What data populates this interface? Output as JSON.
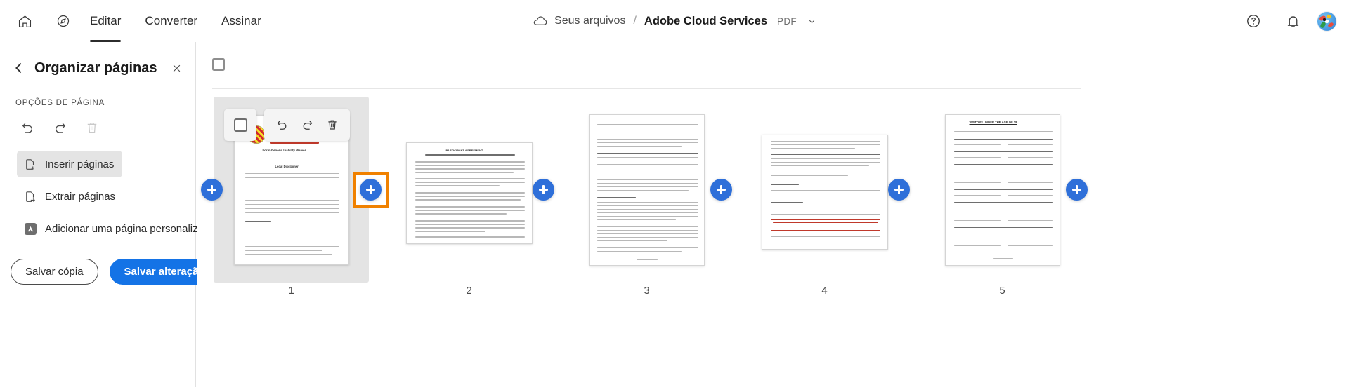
{
  "topbar": {
    "home_icon": "home-icon",
    "compass_icon": "compass-icon",
    "menu": [
      {
        "label": "Editar",
        "active": true
      },
      {
        "label": "Converter",
        "active": false
      },
      {
        "label": "Assinar",
        "active": false
      }
    ],
    "breadcrumb": {
      "cloud_icon": "cloud-icon",
      "root": "Seus arquivos",
      "separator": "/",
      "title": "Adobe Cloud Services",
      "extension": "PDF",
      "caret_icon": "chevron-down-icon"
    },
    "right": {
      "help_icon": "help-circle-icon",
      "bell_icon": "bell-icon",
      "avatar": "user-avatar"
    }
  },
  "panel": {
    "back_icon": "chevron-left-icon",
    "title": "Organizar páginas",
    "close_icon": "close-icon",
    "section_label": "OPÇÕES DE PÁGINA",
    "page_ops": [
      {
        "name": "rotate-left-icon",
        "disabled": false
      },
      {
        "name": "rotate-right-icon",
        "disabled": false
      },
      {
        "name": "delete-icon",
        "disabled": true
      }
    ],
    "items": [
      {
        "label": "Inserir páginas",
        "icon": "insert-page-icon",
        "selected": true
      },
      {
        "label": "Extrair páginas",
        "icon": "extract-page-icon",
        "selected": false
      },
      {
        "label": "Adicionar uma página personalizada",
        "icon": "adobe-logo-icon",
        "selected": false
      }
    ],
    "buttons": {
      "secondary": "Salvar cópia",
      "primary": "Salvar alteração"
    }
  },
  "main": {
    "select_all_checkbox": "select-all-checkbox",
    "hover_toolbar": {
      "checkbox": "page-select-checkbox",
      "rotate_left": "rotate-left-icon",
      "rotate_right": "rotate-right-icon",
      "delete": "delete-icon"
    },
    "insert_button_label": "+",
    "pages": [
      {
        "number": "1",
        "hovered": true
      },
      {
        "number": "2",
        "hovered": false
      },
      {
        "number": "3",
        "hovered": false
      },
      {
        "number": "4",
        "hovered": false
      },
      {
        "number": "5",
        "hovered": false
      }
    ],
    "focused_insert_index": 1
  },
  "colors": {
    "accent_blue": "#1473e6",
    "plus_blue": "#2e6fd9",
    "focus_orange": "#f08100",
    "panel_border": "#e1e1e1",
    "hover_gray": "#e4e4e4"
  }
}
